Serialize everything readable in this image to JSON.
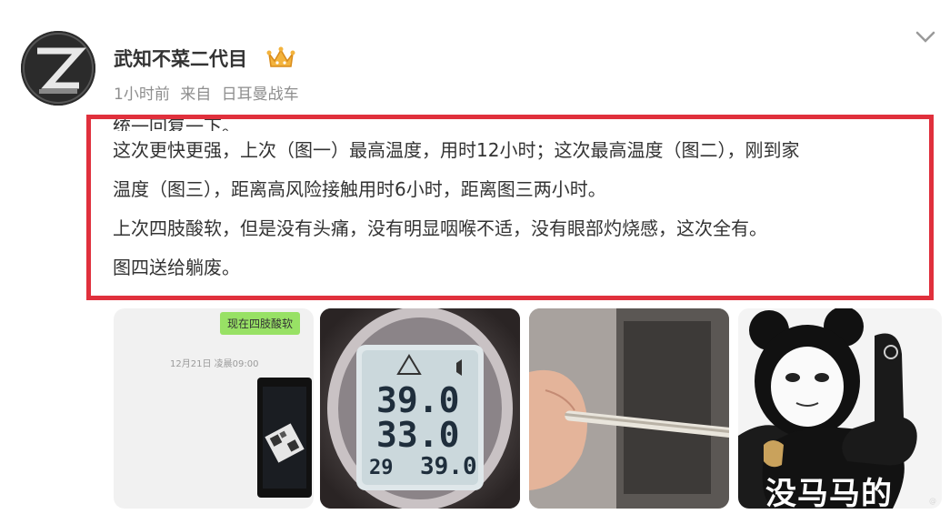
{
  "post": {
    "username": "武知不菜二代目",
    "badge_icon": "crown-icon",
    "time": "1小时前",
    "source_prefix": "来自",
    "source": "日耳曼战车",
    "text_lines": [
      "统一回复一下。",
      "这次更快更强，上次（图一）最高温度，用时12小时；这次最高温度（图二），刚到家",
      "温度（图三），距离高风险接触用时6小时，距离图三两小时。",
      "上次四肢酸软，但是没有头痛，没有明显咽喉不适，没有眼部灼烧感，这次全有。",
      "图四送给躺废。"
    ]
  },
  "images": {
    "chat_bubble": "现在四肢酸软",
    "chat_time": "12月21日 凌晨09:00",
    "thermometer_main": "39.0",
    "thermometer_second": "33.0",
    "thermometer_bottom_left": "29",
    "thermometer_bottom_right": "39.0",
    "meme_caption": "没马马的"
  },
  "colors": {
    "highlight_box": "#e0303c",
    "chat_bubble": "#98e165"
  }
}
